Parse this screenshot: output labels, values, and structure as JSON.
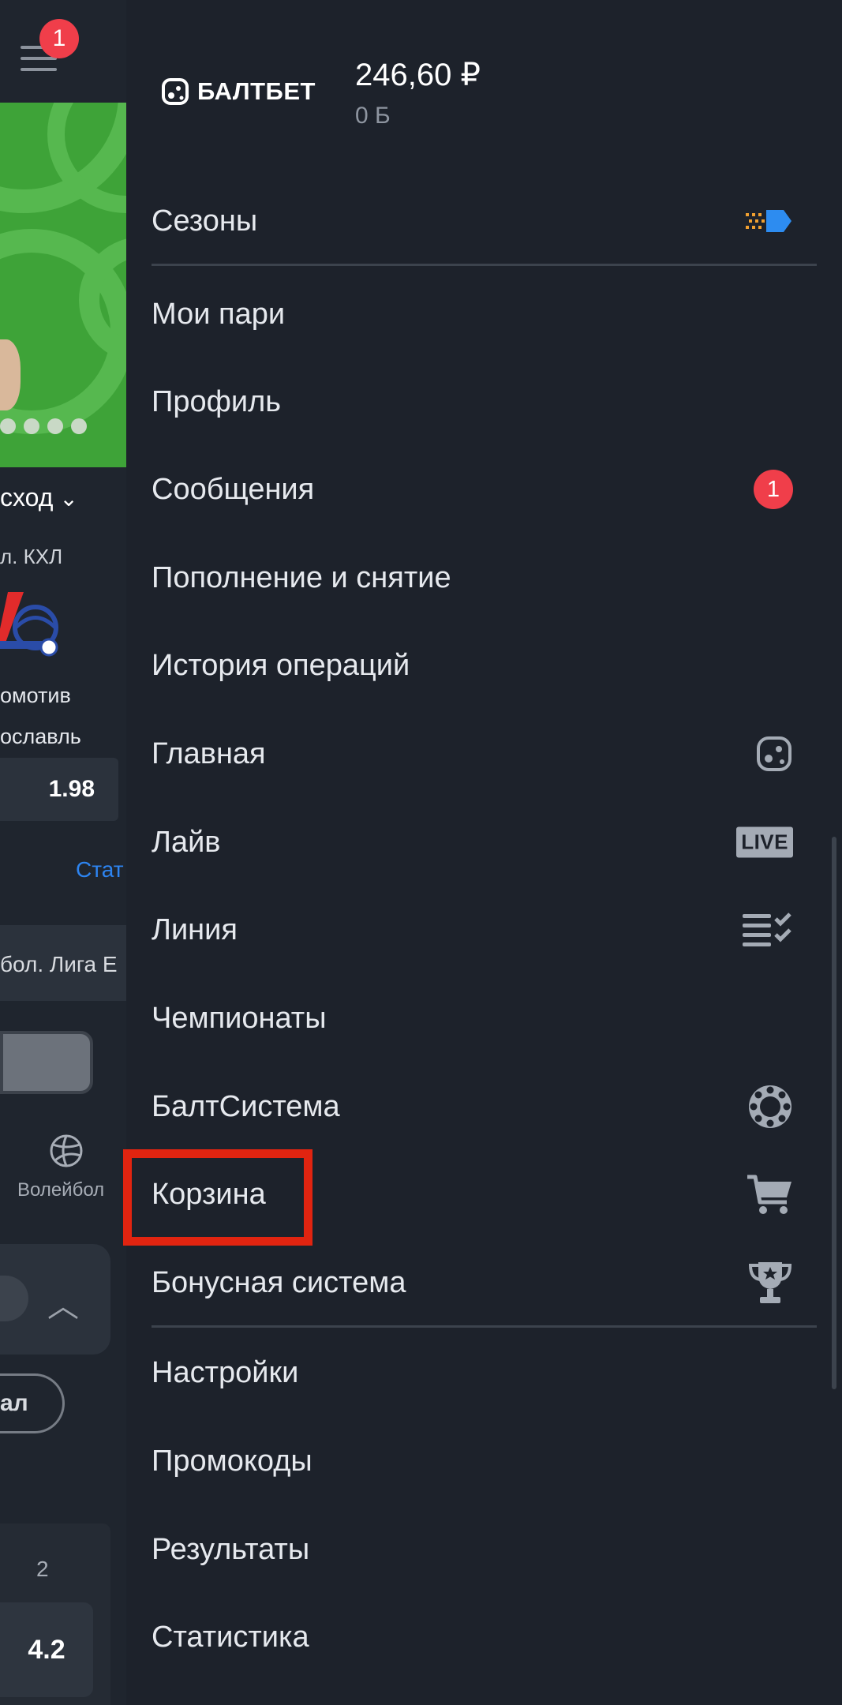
{
  "background": {
    "menu_badge": "1",
    "outcome_label": "сход",
    "league": "л.   КХЛ",
    "team_line1": "омотив",
    "team_line2": "ославль",
    "odd": "1.98",
    "stat_link": "Стат",
    "tournament": "бол. Лига Е",
    "sport_label": "Волейбол",
    "chip_label": "ал",
    "column_label": "2",
    "column_odd": "4.2"
  },
  "header": {
    "brand": "БАЛТБЕТ",
    "balance": "246,60 ₽",
    "bonus": "0 Б"
  },
  "menu": {
    "seasons": "Сезоны",
    "my_bets": "Мои пари",
    "profile": "Профиль",
    "messages": "Сообщения",
    "messages_badge": "1",
    "deposit_withdraw": "Пополнение и снятие",
    "history": "История операций",
    "main": "Главная",
    "live": "Лайв",
    "live_badge": "LIVE",
    "line": "Линия",
    "championships": "Чемпионаты",
    "baltsystem": "БалтСистема",
    "cart": "Корзина",
    "bonus_system": "Бонусная система",
    "settings": "Настройки",
    "promocodes": "Промокоды",
    "results": "Результаты",
    "statistics": "Статистика"
  },
  "colors": {
    "menu_bg": "#1d222b",
    "accent_red": "#f03e4a",
    "highlight": "#e12410",
    "link_blue": "#2d84f0"
  }
}
